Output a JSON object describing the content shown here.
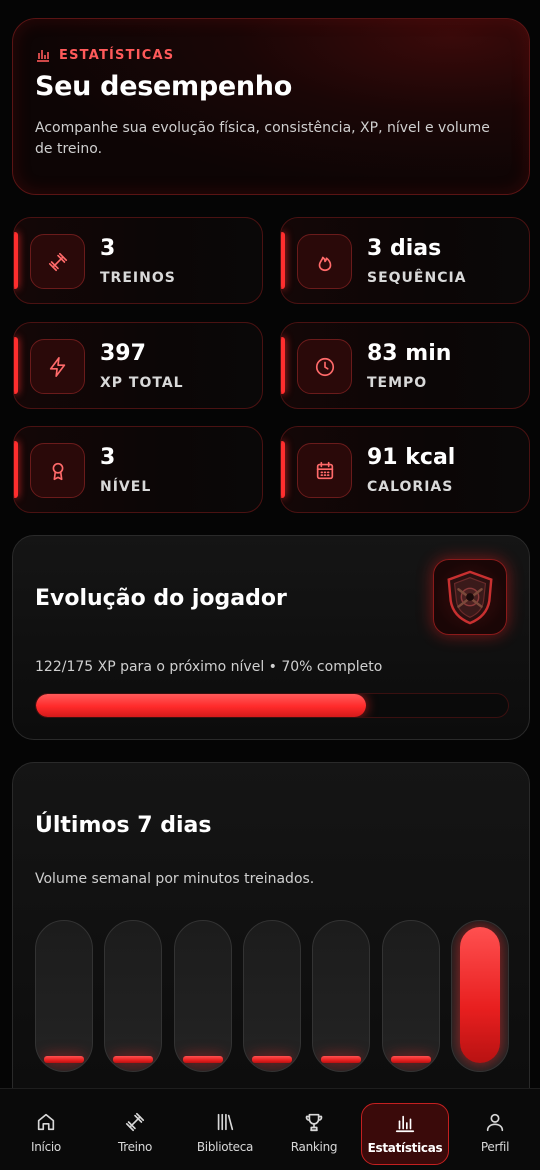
{
  "header": {
    "eyebrow": "ESTATÍSTICAS",
    "title": "Seu desempenho",
    "description": "Acompanhe sua evolução física, consistência, XP, nível e volume de treino."
  },
  "stats": [
    {
      "value": "3",
      "label": "TREINOS",
      "icon": "dumbbell-icon"
    },
    {
      "value": "3 dias",
      "label": "SEQUÊNCIA",
      "icon": "flame-icon"
    },
    {
      "value": "397",
      "label": "XP TOTAL",
      "icon": "lightning-icon"
    },
    {
      "value": "83 min",
      "label": "TEMPO",
      "icon": "clock-icon"
    },
    {
      "value": "3",
      "label": "NÍVEL",
      "icon": "award-icon"
    },
    {
      "value": "91 kcal",
      "label": "CALORIAS",
      "icon": "calendar-icon"
    }
  ],
  "evolution": {
    "title": "Evolução do jogador",
    "progress_text": "122/175 XP para o próximo nível • 70% completo",
    "progress_fraction": 0.7,
    "badge_icon": "shield-emblem-icon"
  },
  "weekly": {
    "title": "Últimos 7 dias",
    "subtitle": "Volume semanal por minutos treinados.",
    "bar_fill_fractions": [
      0.05,
      0.05,
      0.05,
      0.05,
      0.05,
      0.05,
      1.0
    ]
  },
  "nav": {
    "items": [
      {
        "label": "Início",
        "icon": "home-icon"
      },
      {
        "label": "Treino",
        "icon": "dumbbell-icon"
      },
      {
        "label": "Biblioteca",
        "icon": "library-icon"
      },
      {
        "label": "Ranking",
        "icon": "trophy-icon"
      },
      {
        "label": "Estatísticas",
        "icon": "bar-chart-icon"
      },
      {
        "label": "Perfil",
        "icon": "user-icon"
      }
    ],
    "active": "Estatísticas"
  },
  "colors": {
    "accent": "#ff2e2e",
    "background": "#050505"
  }
}
